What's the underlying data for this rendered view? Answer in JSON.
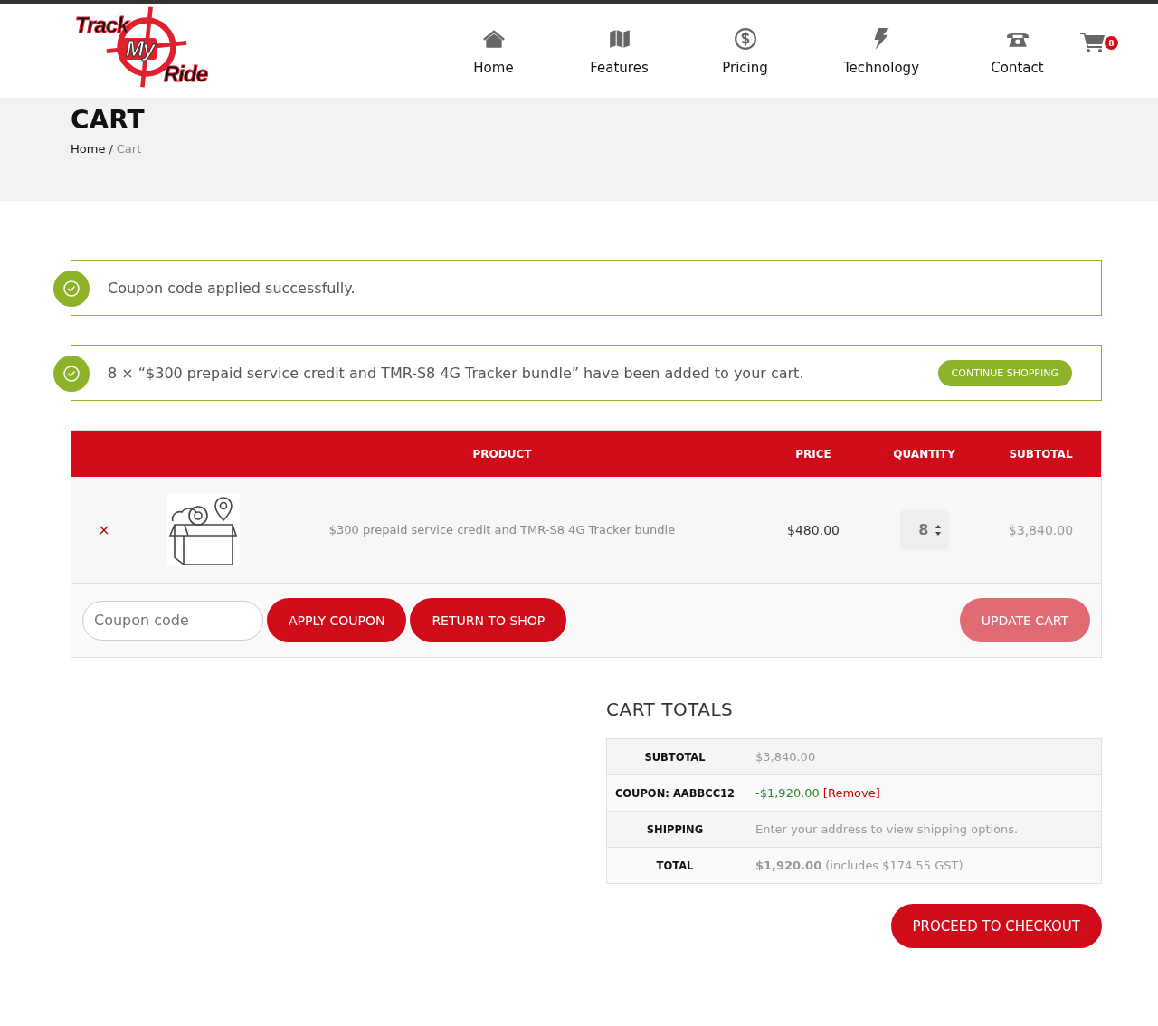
{
  "logo": {
    "words": [
      "Track",
      "My",
      "Ride"
    ]
  },
  "nav": [
    {
      "label": "Home",
      "kind": "home"
    },
    {
      "label": "Features",
      "kind": "map"
    },
    {
      "label": "Pricing",
      "kind": "dollar"
    },
    {
      "label": "Technology",
      "kind": "bolt"
    },
    {
      "label": "Contact",
      "kind": "phone"
    }
  ],
  "cart_badge": "8",
  "page_title": "CART",
  "breadcrumb_separator": "/",
  "breadcrumb": [
    {
      "label": "Home",
      "current": false
    },
    {
      "label": "Cart",
      "current": true
    }
  ],
  "notices": [
    {
      "text": "Coupon code applied successfully."
    },
    {
      "text": "8 × “$300 prepaid service credit and TMR-S8 4G Tracker bundle” have been added to your cart.",
      "button": "CONTINUE SHOPPING"
    }
  ],
  "cart_table": {
    "columns": [
      "PRODUCT",
      "PRICE",
      "QUANTITY",
      "SUBTOTAL"
    ],
    "rows": [
      {
        "remove": "×",
        "product": "$300 prepaid service credit and TMR-S8 4G Tracker bundle",
        "price": "$480.00",
        "quantity": "8",
        "subtotal": "$3,840.00"
      }
    ]
  },
  "coupon_field": {
    "placeholder": "Coupon code"
  },
  "buttons": [
    {
      "label": "APPLY COUPON",
      "disabled": false
    },
    {
      "label": "RETURN TO SHOP",
      "disabled": false
    }
  ],
  "update_button": {
    "label": "UPDATE CART",
    "disabled": true
  },
  "totals": {
    "title": "CART TOTALS",
    "rows": [
      {
        "kind": "plain",
        "label": "SUBTOTAL",
        "value": "$3,840.00"
      },
      {
        "kind": "coupon",
        "label": "COUPON: AABBCC12",
        "value": "-$1,920.00",
        "link": "[Remove]"
      },
      {
        "kind": "plain",
        "label": "SHIPPING",
        "value": "Enter your address to view shipping options."
      },
      {
        "kind": "total",
        "label": "TOTAL",
        "value": "$1,920.00",
        "note": "(includes $174.55 GST)"
      }
    ]
  },
  "checkout_button": "PROCEED TO CHECKOUT"
}
